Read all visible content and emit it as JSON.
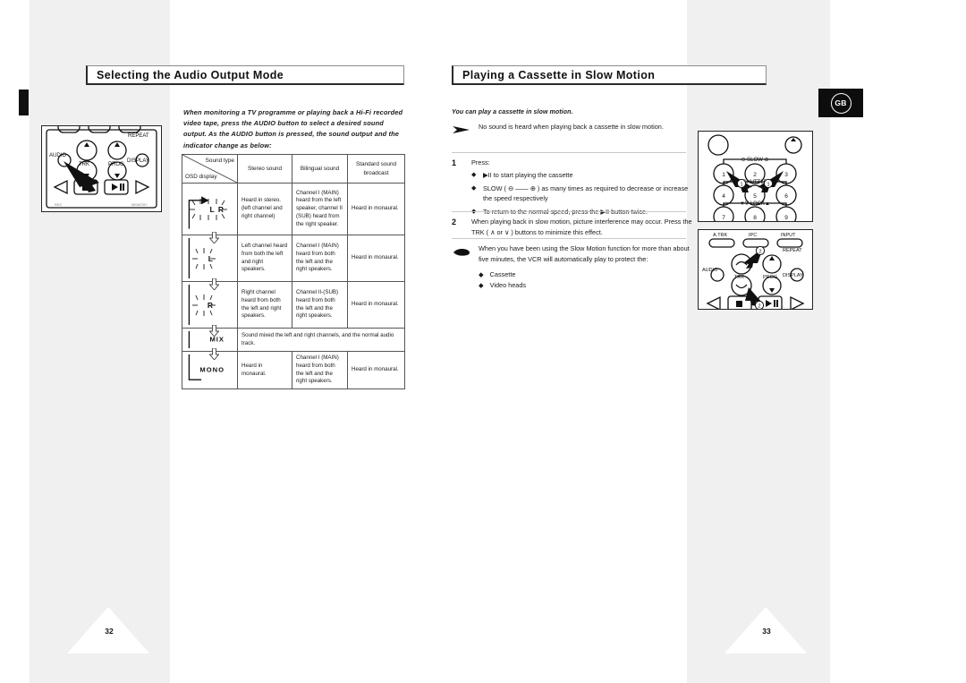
{
  "spread": {
    "country_badge": "GB",
    "left_page_number": "32",
    "right_page_number": "33"
  },
  "left_page": {
    "title": "Selecting the Audio Output Mode",
    "intro": "When monitoring a TV programme or playing back a Hi-Fi recorded video tape, press the AUDIO button to select a desired sound output. As the AUDIO button is pressed, the sound output and the indicator change as below:",
    "remote": {
      "name": "vcr-remote-audio-buttons",
      "labels": [
        "REPEAT",
        "AUDIO",
        "DISPLAY",
        "TRK",
        "PROG",
        "REC",
        "MEMORY"
      ]
    },
    "table": {
      "header_diagonal_top": "Sound type",
      "header_diagonal_bottom": "OSD display",
      "columns": [
        "Stereo sound",
        "Bilingual sound",
        "Standard sound broadcast"
      ],
      "rows": [
        {
          "indicator": "L R",
          "indicator_style": "blinking",
          "stereo": "Heard in stereo. (left channel and right channel)",
          "bilingual": "Channel I (MAIN) heard from the left speaker, channel II (SUB) heard from the right speaker.",
          "standard": "Heard in monaural."
        },
        {
          "indicator": "L",
          "indicator_style": "blinking",
          "stereo": "Left channel heard from both the left and right speakers.",
          "bilingual": "Channel I (MAIN) heard from both the left and the right speakers.",
          "standard": "Heard in monaural."
        },
        {
          "indicator": "R",
          "indicator_style": "blinking",
          "stereo": "Right channel heard from both the left and right speakers.",
          "bilingual": "Channel II-(SUB) heard from both the left and the right speakers.",
          "standard": "Heard in monaural."
        },
        {
          "indicator": "MIX",
          "indicator_style": "plain",
          "merged": "Sound mixed the left and right channels, and the normal audio track."
        },
        {
          "indicator": "MONO",
          "indicator_style": "plain",
          "stereo": "Heard in monaural.",
          "bilingual": "Channel I (MAIN) heard from both the left and the right speakers.",
          "standard": "Heard in monaural."
        }
      ]
    }
  },
  "right_page": {
    "title": "Playing a Cassette in Slow Motion",
    "lead": "You can play a cassette in slow motion.",
    "note": "No sound is heard when playing back a cassette in slow motion.",
    "steps": [
      {
        "number": "1",
        "text": "Press:",
        "bullets": [
          "▶II to start playing the cassette",
          "SLOW ( ⊖ —— ⊕ ) as many times as required to decrease or increase the speed respectively",
          "To return to the normal speed, press the ▶II button twice."
        ]
      },
      {
        "number": "2",
        "text": "When playing back in slow motion, picture interference may occur. Press the TRK ( ∧ or ∨ ) buttons to minimize this effect.",
        "bullets": []
      }
    ],
    "tip": {
      "text": "When you have been using the Slow Motion function for more than about five minutes, the VCR will automatically play to protect the:",
      "items": [
        "Cassette",
        "Video heads"
      ]
    },
    "remote_top": {
      "name": "vcr-remote-numeric-keypad",
      "labels": [
        "SLOW",
        "SHUTTLE",
        "V-LOCK"
      ],
      "keys": [
        "1",
        "2",
        "3",
        "4",
        "5",
        "6",
        "7",
        "8",
        "9"
      ],
      "callout": "1"
    },
    "remote_bottom": {
      "name": "vcr-remote-trk-buttons",
      "labels": [
        "A.TRK",
        "IPC",
        "INPUT",
        "REPEAT",
        "AUDIO",
        "DISPLAY",
        "TRK",
        "PROG"
      ],
      "callout": "2"
    }
  }
}
